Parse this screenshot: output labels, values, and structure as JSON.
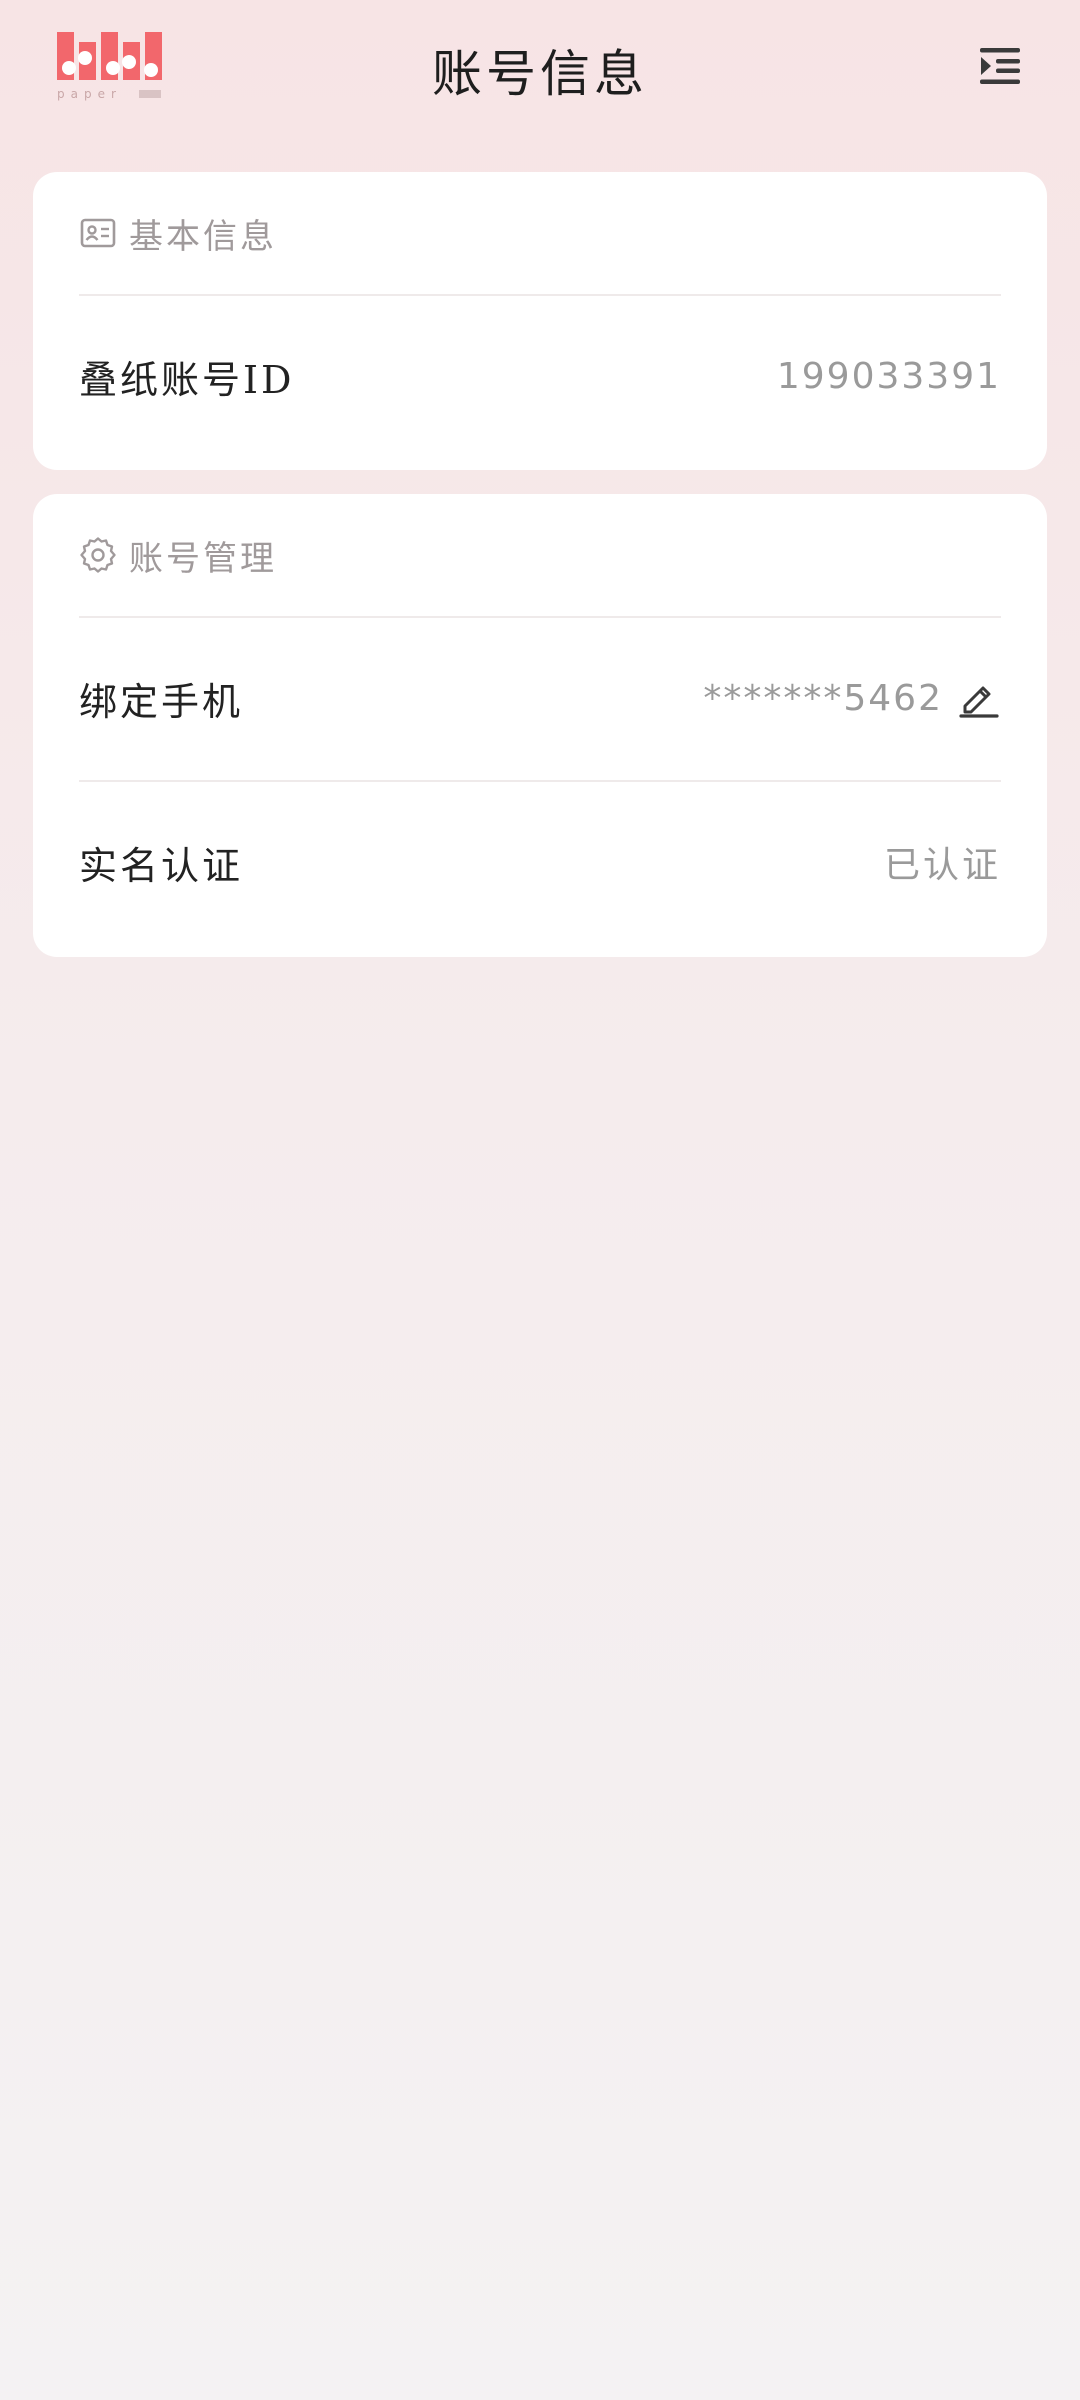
{
  "header": {
    "title": "账号信息",
    "logo_text": "paper · 叠纸"
  },
  "basic_section": {
    "title": "基本信息",
    "icon": "id-card-icon",
    "rows": [
      {
        "label": "叠纸账号ID",
        "value": "199033391"
      }
    ]
  },
  "manage_section": {
    "title": "账号管理",
    "icon": "gear-icon",
    "rows": [
      {
        "label": "绑定手机",
        "value": "*******5462",
        "action_icon": "edit-icon"
      },
      {
        "label": "实名认证",
        "value": "已认证"
      }
    ]
  },
  "colors": {
    "logo_red": "#f2676c",
    "muted_text": "#a09a9b",
    "icon_dark": "#3a3a3a"
  }
}
